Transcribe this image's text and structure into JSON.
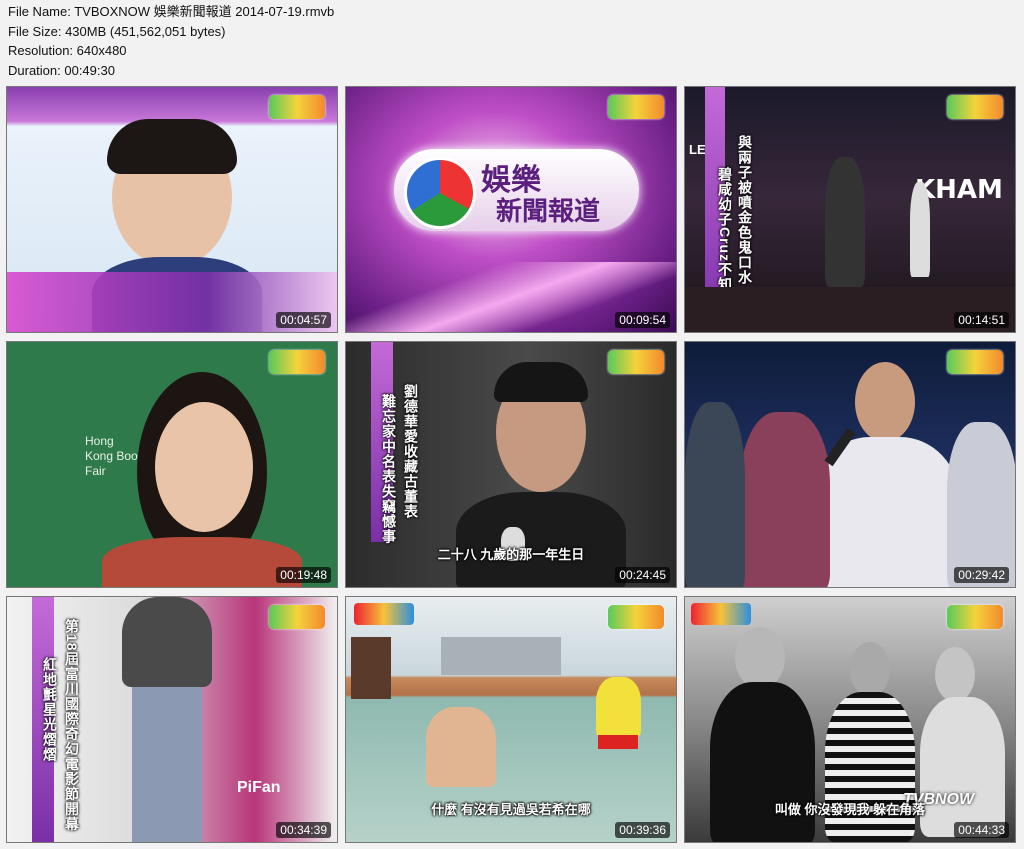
{
  "file_info": {
    "file_name": "File Name: TVBOXNOW 娛樂新聞報道 2014-07-19.rmvb",
    "file_size": "File Size: 430MB (451,562,051 bytes)",
    "resolution": "Resolution: 640x480",
    "duration": "Duration: 00:49:30"
  },
  "thumbnails": [
    {
      "timestamp": "00:04:57"
    },
    {
      "timestamp": "00:09:54",
      "title_line1": "娛樂",
      "title_line2": "新聞報道"
    },
    {
      "timestamp": "00:14:51",
      "caption_col1": "與兩子被噴金色鬼口水",
      "caption_col2": "碧咸幼子Cruz不知所措",
      "sign_left": "LEG",
      "sign_right": "KHAM"
    },
    {
      "timestamp": "00:19:48",
      "sign_text": "Hong Kong Book Fair"
    },
    {
      "timestamp": "00:24:45",
      "caption_col1": "劉德華愛收藏古董表",
      "caption_col2": "難忘家中名表失竊憾事",
      "subtitle": "二十八 九歲的那一年生日"
    },
    {
      "timestamp": "00:29:42"
    },
    {
      "timestamp": "00:34:39",
      "caption_col1": "第18屆富川國際奇幻電影節開幕",
      "caption_col2": "紅地氈星光熠熠",
      "sign_text": "PiFan"
    },
    {
      "timestamp": "00:39:36",
      "subtitle": "什麼 有沒有見過吳若希在哪"
    },
    {
      "timestamp": "00:44:33",
      "subtitle": "叫做 你沒發現我 躲在角落",
      "watermark": "TVBNOW"
    }
  ],
  "colors": {
    "purple": "#9b3fb8",
    "magenta": "#d94ad0",
    "green_bg": "#2f7a4a",
    "pool": "#8fb9b0"
  }
}
